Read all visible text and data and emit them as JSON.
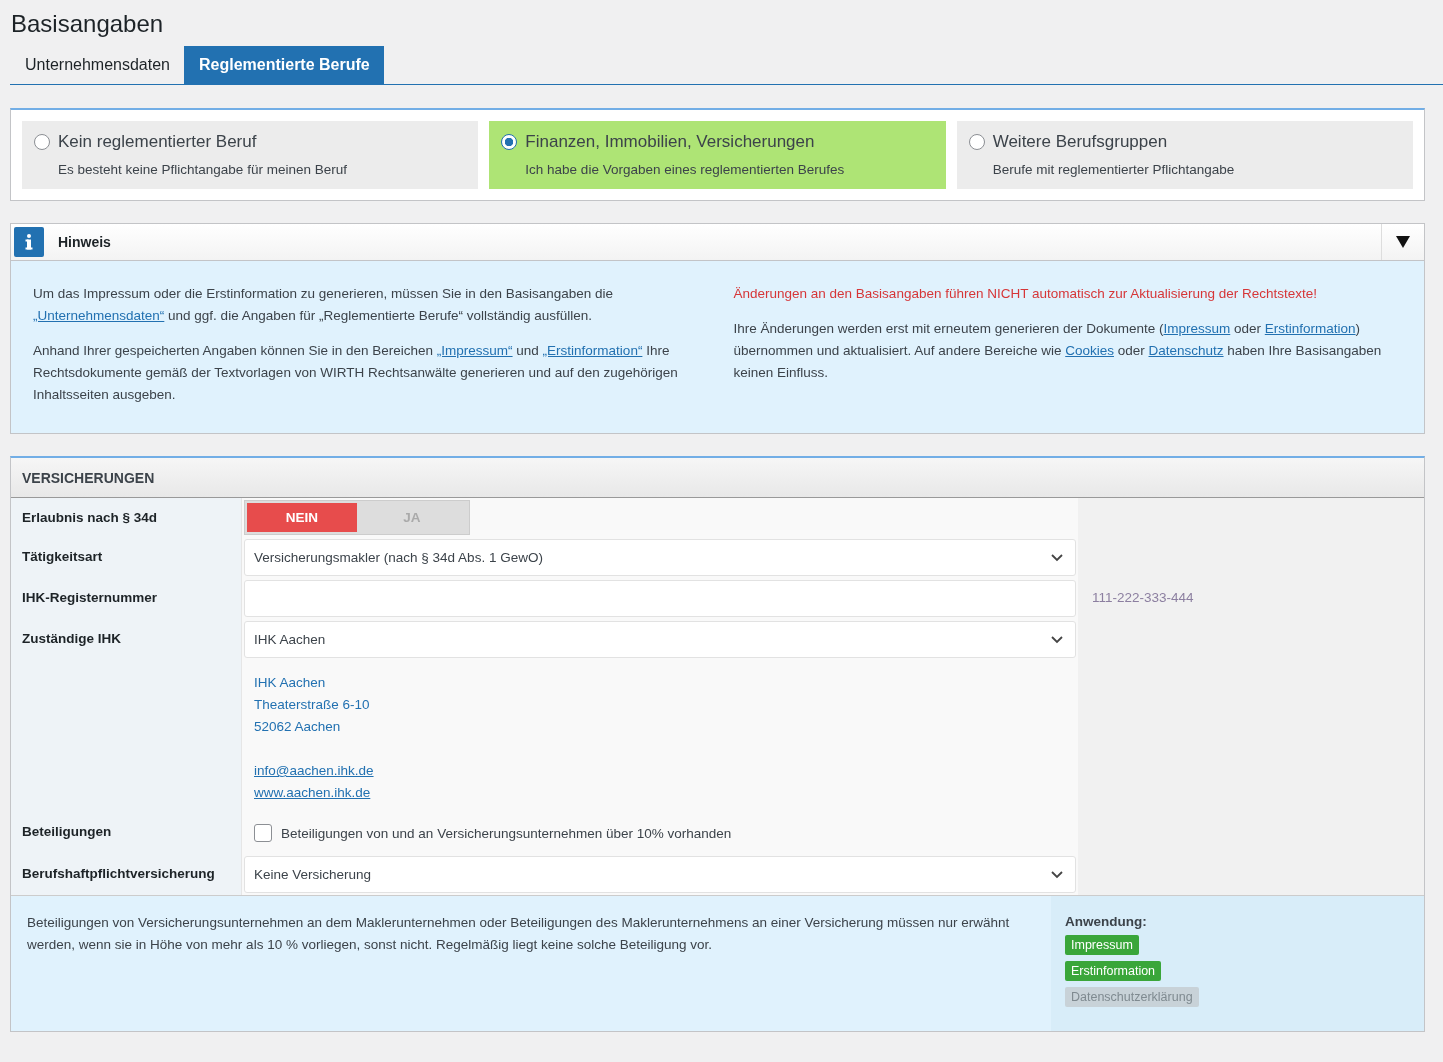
{
  "page_title": "Basisangaben",
  "tabs": [
    {
      "label": "Unternehmensdaten",
      "selected": false
    },
    {
      "label": "Reglementierte Berufe",
      "selected": true
    }
  ],
  "professions": [
    {
      "title": "Kein reglementierter Beruf",
      "description": "Es besteht keine Pflichtangabe für meinen Beruf",
      "selected": false
    },
    {
      "title": "Finanzen, Immobilien, Versicherungen",
      "description": "Ich habe die Vorgaben eines reglementierten Berufes",
      "selected": true
    },
    {
      "title": "Weitere Berufsgruppen",
      "description": "Berufe mit reglementierter Pflichtangabe",
      "selected": false
    }
  ],
  "notice": {
    "title": "Hinweis",
    "expanded": true,
    "left": [
      [
        {
          "kind": "text",
          "text": "Um das Impressum oder die Erstinformation zu generieren, müssen Sie in den Basisangaben die "
        },
        {
          "kind": "link",
          "text": "„Unternehmensdaten“"
        },
        {
          "kind": "text",
          "text": " und ggf. die Angaben für „Reglementierte Berufe“ vollständig ausfüllen."
        }
      ],
      [
        {
          "kind": "text",
          "text": "Anhand Ihrer gespeicherten Angaben können Sie in den Bereichen "
        },
        {
          "kind": "link",
          "text": "„Impressum“"
        },
        {
          "kind": "text",
          "text": " und "
        },
        {
          "kind": "link",
          "text": "„Erstinformation“"
        },
        {
          "kind": "text",
          "text": " Ihre Rechtsdokumente gemäß der Textvorlagen von WIRTH Rechtsanwälte generieren und auf den zugehörigen Inhaltsseiten ausgeben."
        }
      ]
    ],
    "warning": "Änderungen an den Basisangaben führen NICHT automatisch zur Aktualisierung der Rechtstexte!",
    "right": [
      [
        {
          "kind": "text",
          "text": "Ihre Änderungen werden erst mit erneutem generieren der Dokumente ("
        },
        {
          "kind": "link",
          "text": "Impressum"
        },
        {
          "kind": "text",
          "text": " oder "
        },
        {
          "kind": "link",
          "text": "Erstinformation"
        },
        {
          "kind": "text",
          "text": ") übernommen und aktualisiert. Auf andere Bereiche wie "
        },
        {
          "kind": "link",
          "text": "Cookies"
        },
        {
          "kind": "text",
          "text": " oder "
        },
        {
          "kind": "link",
          "text": "Datenschutz"
        },
        {
          "kind": "text",
          "text": " haben Ihre Basisangaben keinen Einfluss."
        }
      ]
    ]
  },
  "section": {
    "title": "VERSICHERUNGEN",
    "rows": [
      {
        "label": "Erlaubnis nach § 34d",
        "kind": "toggle",
        "options": [
          {
            "label": "NEIN",
            "selected": true
          },
          {
            "label": "JA",
            "selected": false
          }
        ]
      },
      {
        "label": "Tätigkeitsart",
        "kind": "select",
        "value": "Versicherungsmakler (nach § 34d Abs. 1 GewO)"
      },
      {
        "label": "IHK-Registernummer",
        "kind": "input",
        "hint": "111-222-333-444"
      },
      {
        "label": "Zuständige IHK",
        "kind": "select",
        "value": "IHK Aachen",
        "address": [
          "IHK Aachen",
          "Theaterstraße 6-10",
          "52062 Aachen"
        ],
        "links": [
          "info@aachen.ihk.de",
          "www.aachen.ihk.de"
        ]
      },
      {
        "label": "Beteiligungen",
        "kind": "checkbox",
        "text": "Beteiligungen von und an Versicherungsunternehmen über 10% vorhanden",
        "checked": false
      },
      {
        "label": "Berufshaftpflichtversicherung",
        "kind": "select",
        "value": "Keine Versicherung"
      }
    ],
    "footer": {
      "text": "Beteiligungen von Versicherungsunternehmen an dem Maklerunternehmen oder Beteiligungen des Maklerunternehmens an einer Versicherung müssen nur erwähnt werden, wenn sie in Höhe von mehr als 10 % vorliegen, sonst nicht. Regelmäßig liegt keine solche Beteiligung vor.",
      "usage_label": "Anwendung:",
      "tags": [
        {
          "label": "Impressum",
          "active": true
        },
        {
          "label": "Erstinformation",
          "active": true
        },
        {
          "label": "Datenschutzerklärung",
          "active": false
        }
      ]
    }
  }
}
